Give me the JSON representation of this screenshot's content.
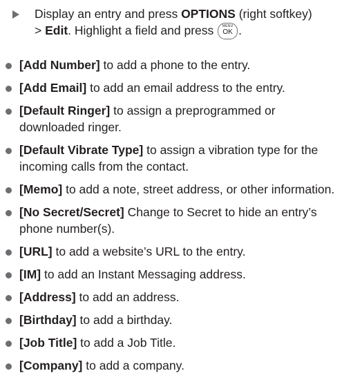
{
  "intro": {
    "part1": "Display an entry and press ",
    "options_label": "OPTIONS",
    "part2": " (right softkey)",
    "gt": ">",
    "edit_label": "Edit",
    "part3": ". Highlight a field and press ",
    "key_menu": "MENU",
    "key_ok": "OK",
    "part4": "."
  },
  "items": [
    {
      "label": "[Add Number]",
      "text": " to add a phone to the entry."
    },
    {
      "label": "[Add Email]",
      "text": " to add an email address to the entry."
    },
    {
      "label": "[Default Ringer]",
      "text": " to assign a preprogrammed or downloaded ringer."
    },
    {
      "label": "[Default Vibrate Type]",
      "text": " to assign a vibration type for the incoming calls from the contact."
    },
    {
      "label": "[Memo]",
      "text": " to add a note, street address, or other information."
    },
    {
      "label": "[No Secret/Secret]",
      "text": " Change to Secret to hide an entry’s phone number(s)."
    },
    {
      "label": "[URL]",
      "text": " to add a website’s URL to the entry."
    },
    {
      "label": "[IM]",
      "text": " to add an Instant Messaging address."
    },
    {
      "label": "[Address]",
      "text": " to add an address."
    },
    {
      "label": "[Birthday]",
      "text": " to add a birthday."
    },
    {
      "label": "[Job Title]",
      "text": " to add a Job Title."
    },
    {
      "label": "[Company]",
      "text": " to add a company."
    }
  ],
  "icons": {
    "step": "triangle-arrow-icon",
    "bullet": "bullet-dot-icon",
    "key": "menu-ok-key-icon"
  },
  "colors": {
    "text": "#231f20",
    "marker": "#6d6e71"
  }
}
